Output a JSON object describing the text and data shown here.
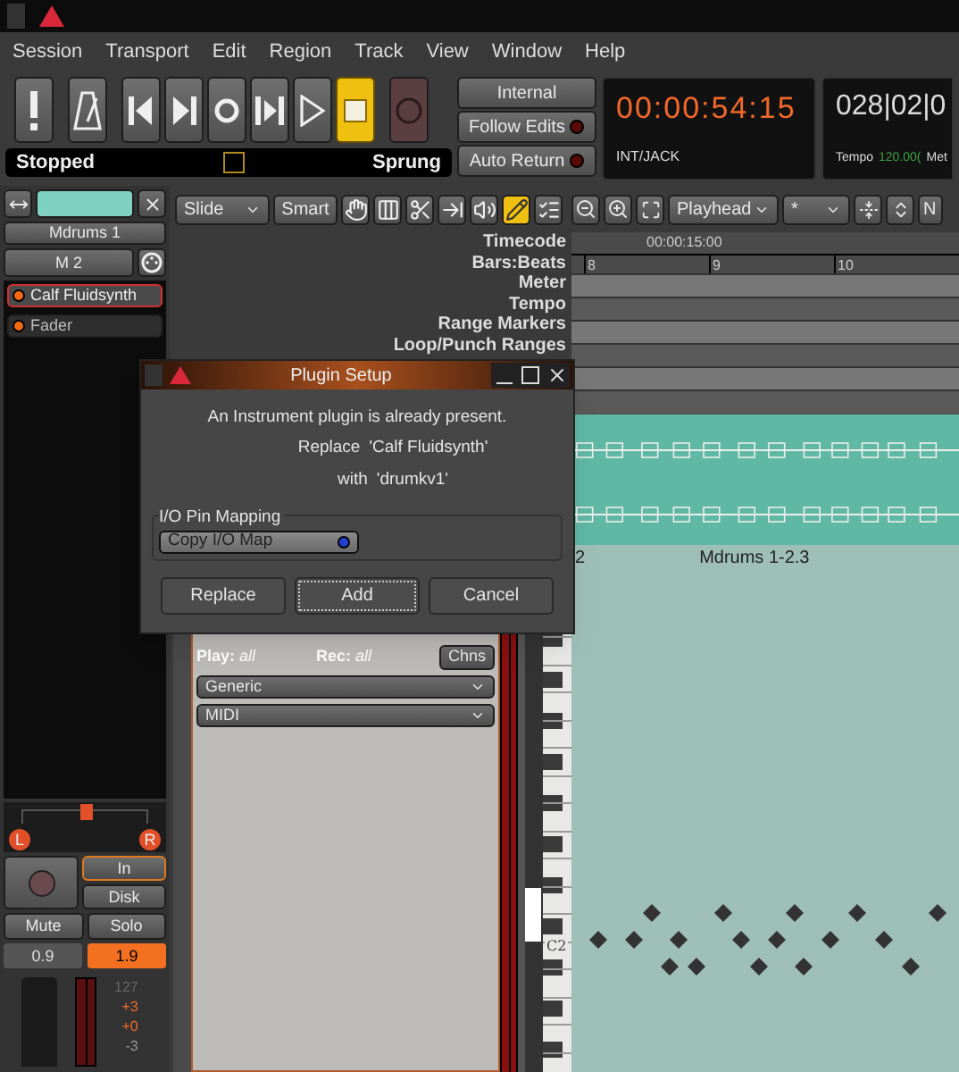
{
  "menu": [
    "Session",
    "Transport",
    "Edit",
    "Region",
    "Track",
    "View",
    "Window",
    "Help"
  ],
  "transport_buttons": [
    {
      "kind": "panic",
      "active": false
    },
    {
      "kind": "metronome",
      "active": false
    },
    {
      "kind": "start",
      "active": false
    },
    {
      "kind": "end",
      "active": false
    },
    {
      "kind": "loop",
      "active": false
    },
    {
      "kind": "range",
      "active": false
    },
    {
      "kind": "play",
      "active": false
    },
    {
      "kind": "stop",
      "active": true
    },
    {
      "kind": "record",
      "active": false
    }
  ],
  "status": {
    "state": "Stopped",
    "mode": "Sprung",
    "checked": false
  },
  "sync_buttons": [
    {
      "label": "Internal",
      "kind": "plain"
    },
    {
      "label": "Follow Edits",
      "kind": "led",
      "on": false
    },
    {
      "label": "Auto Return",
      "kind": "led",
      "on": false
    }
  ],
  "clock": {
    "time": "00:00:54:15",
    "source": "INT/JACK"
  },
  "bbt": {
    "position": "028|02|0",
    "tempo_label": "Tempo",
    "tempo_value": "120.00(",
    "meter_label": "Met"
  },
  "strip": {
    "name": "Mdrums 1",
    "input": "M 2",
    "plugins": [
      {
        "name": "Calf Fluidsynth",
        "selected": true
      },
      {
        "name": "Fader",
        "selected": false
      }
    ],
    "pan": {
      "left": "L",
      "right": "R",
      "level": 0.5
    },
    "record_armed": false,
    "monitor": [
      {
        "label": "In",
        "selected": true
      },
      {
        "label": "Disk",
        "selected": false
      }
    ],
    "mute": {
      "label": "Mute",
      "on": false
    },
    "solo": {
      "label": "Solo",
      "on": false
    },
    "gains": [
      {
        "text": "0.9",
        "highlighted": false
      },
      {
        "text": "1.9",
        "highlighted": true
      }
    ],
    "meter_marks": [
      {
        "text": "127",
        "kind": "peak"
      },
      {
        "text": "+3",
        "kind": "hot"
      },
      {
        "text": "+0",
        "kind": "hot"
      },
      {
        "text": "-3",
        "kind": "cold"
      }
    ]
  },
  "editor": {
    "edit_mode": "Slide",
    "grid_mode": "Smart",
    "tools": [
      {
        "kind": "grab",
        "selected": false
      },
      {
        "kind": "range",
        "selected": false
      },
      {
        "kind": "cut",
        "selected": false
      },
      {
        "kind": "stretch",
        "selected": false
      },
      {
        "kind": "audition",
        "selected": false
      },
      {
        "kind": "draw",
        "selected": true
      },
      {
        "kind": "internal-edit",
        "selected": false
      }
    ],
    "zoom_focus": "Playhead",
    "grid": "*",
    "cut_button": "N",
    "rulers": [
      "Timecode",
      "Bars:Beats",
      "Meter",
      "Tempo",
      "Range Markers",
      "Loop/Punch Ranges"
    ],
    "timecode_marks": [
      "00:00:15:00"
    ],
    "bar_marks": [
      "8",
      "9",
      "10"
    ],
    "track": {
      "play": "**Play:** *all*",
      "rec": "**Rec:** *all*",
      "channels_button": "Chns",
      "dropdowns": [
        "Generic",
        "MIDI"
      ]
    },
    "region": {
      "prefix": "2",
      "name": "Mdrums 1-2.3"
    },
    "key_label": "C2"
  },
  "dialog": {
    "title": "Plugin Setup",
    "message": "An Instrument plugin is already present.",
    "lines": [
      {
        "word": "Replace",
        "value": "'Calf Fluidsynth'"
      },
      {
        "word": "with",
        "value": "'drumkv1'"
      }
    ],
    "group_label": "I/O Pin Mapping",
    "toggle": {
      "label": "Copy I/O Map",
      "on": true
    },
    "buttons": [
      {
        "label": "Replace",
        "focused": false
      },
      {
        "label": "Add",
        "focused": true
      },
      {
        "label": "Cancel",
        "focused": false
      }
    ]
  }
}
